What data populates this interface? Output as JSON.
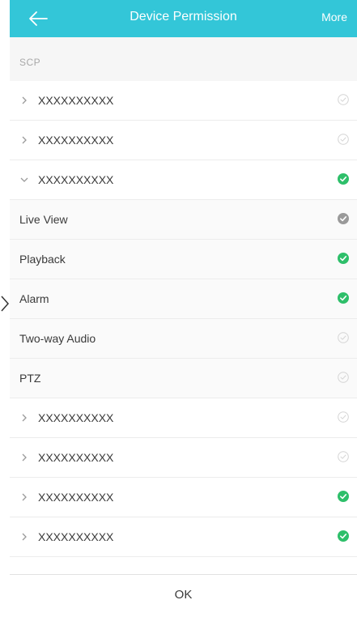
{
  "header": {
    "title": "Device Permission",
    "more_label": "More",
    "back_icon": "arrow-left-icon",
    "background_color": "#33c6d8"
  },
  "section": {
    "label": "SCP"
  },
  "rows": [
    {
      "type": "group",
      "label": "XXXXXXXXXX",
      "expanded": false,
      "status": "unchecked"
    },
    {
      "type": "group",
      "label": "XXXXXXXXXX",
      "expanded": false,
      "status": "unchecked"
    },
    {
      "type": "group",
      "label": "XXXXXXXXXX",
      "expanded": true,
      "status": "checked"
    },
    {
      "type": "sub",
      "label": "Live View",
      "status": "partial"
    },
    {
      "type": "sub",
      "label": "Playback",
      "status": "checked"
    },
    {
      "type": "sub",
      "label": "Alarm",
      "status": "checked"
    },
    {
      "type": "sub",
      "label": "Two-way Audio",
      "status": "unchecked"
    },
    {
      "type": "sub",
      "label": "PTZ",
      "status": "unchecked"
    },
    {
      "type": "group",
      "label": "XXXXXXXXXX",
      "expanded": false,
      "status": "unchecked"
    },
    {
      "type": "group",
      "label": "XXXXXXXXXX",
      "expanded": false,
      "status": "unchecked"
    },
    {
      "type": "group",
      "label": "XXXXXXXXXX",
      "expanded": false,
      "status": "checked"
    },
    {
      "type": "group",
      "label": "XXXXXXXXXX",
      "expanded": false,
      "status": "checked"
    }
  ],
  "footer": {
    "ok_label": "OK"
  },
  "colors": {
    "checked": "#2ebf6a",
    "partial": "#9a9a9a",
    "unchecked_stroke": "#d4d4d4"
  }
}
